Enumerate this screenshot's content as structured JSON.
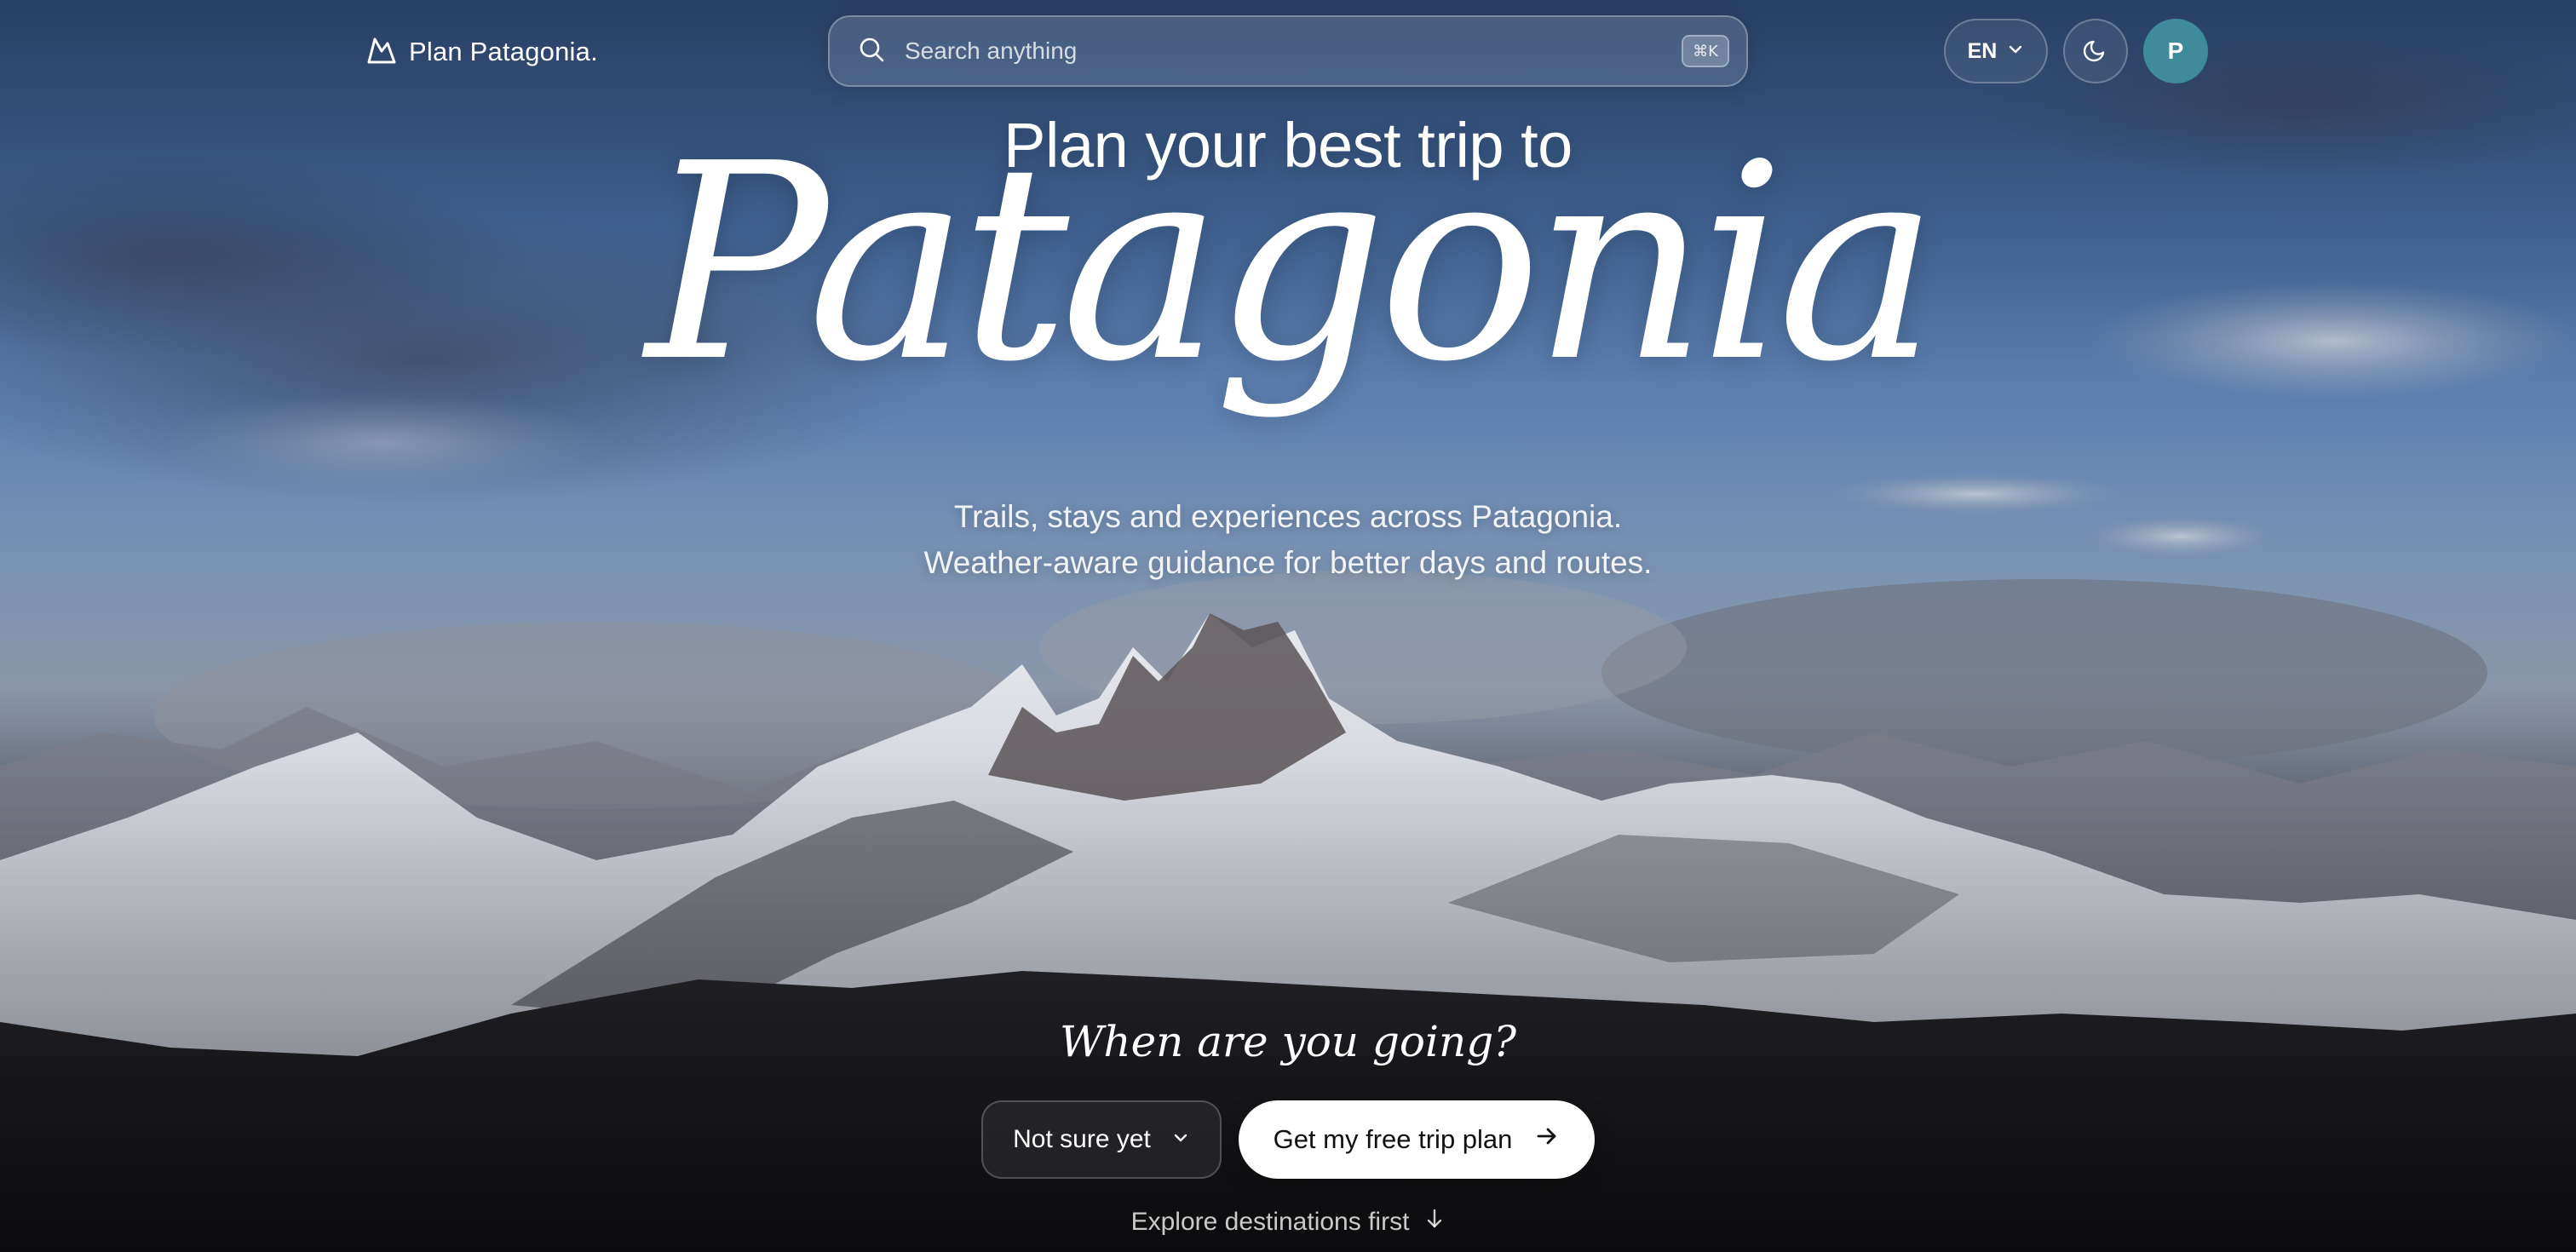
{
  "brand": {
    "name": "Plan Patagonia.",
    "icon": "mountain-icon"
  },
  "search": {
    "placeholder": "Search anything",
    "shortcut": "⌘K",
    "icon": "search-icon"
  },
  "header": {
    "language": "EN",
    "theme_icon": "moon-icon",
    "avatar_initial": "P"
  },
  "hero": {
    "pre_title": "Plan your best trip to",
    "title": "Patagonia",
    "subtitle_line1": "Trails, stays and experiences across Patagonia.",
    "subtitle_line2": "Weather-aware guidance for better days and routes."
  },
  "planner": {
    "question": "When are you going?",
    "when_value": "Not sure yet",
    "cta_label": "Get my free trip plan",
    "explore_label": "Explore destinations first"
  },
  "colors": {
    "avatar": "#3f8a9b",
    "cta_bg": "#ffffff",
    "cta_text": "#111111"
  }
}
